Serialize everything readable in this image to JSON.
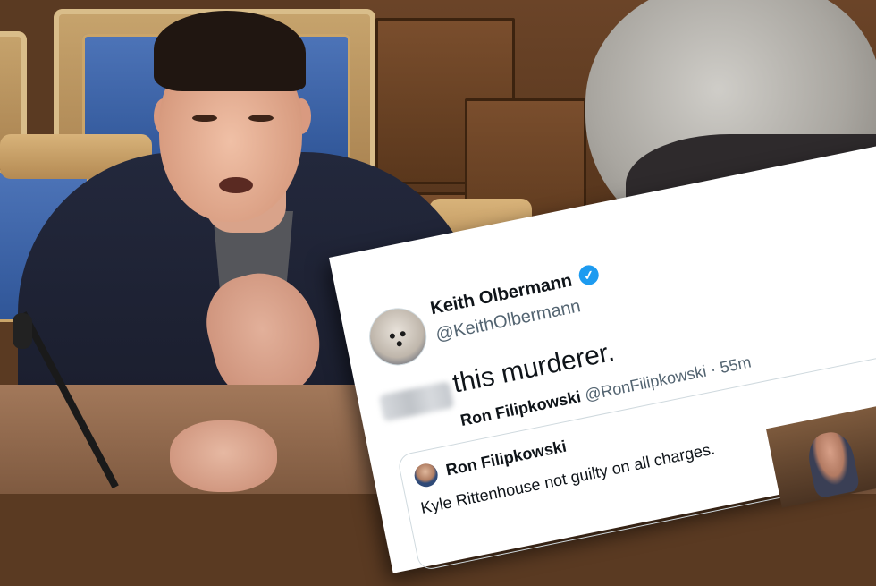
{
  "tweet": {
    "author_name": "Keith Olbermann",
    "author_handle": "@KeithOlbermann",
    "verified_badge": "✓",
    "text": "this murderer.",
    "quoted": {
      "author_name": "Ron Filipkowski",
      "author_handle": "@RonFilipkowski",
      "separator": "·",
      "time": "55m",
      "text": "Kyle Rittenhouse not guilty on all charges."
    }
  },
  "colors": {
    "verified": "#1d9bf0",
    "secondary_text": "#536471",
    "card_background": "#ffffff"
  }
}
